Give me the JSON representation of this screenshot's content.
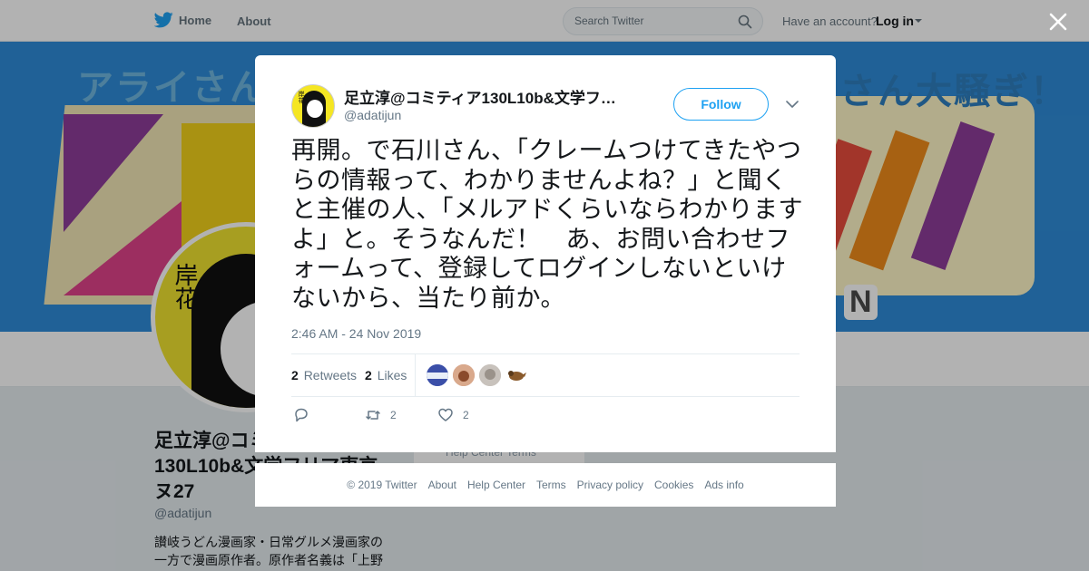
{
  "nav": {
    "home_label": "Home",
    "about_label": "About",
    "search_placeholder": "Search Twitter",
    "account_prompt": "Have an account?",
    "login_label": "Log in"
  },
  "profile": {
    "banner_text_left": "アライさん",
    "banner_text_right": "さん大騒ぎ！",
    "banner_n": "N",
    "avatar_text": "岸花",
    "name": "足立淳@コミティア130L10b&文学フリマ東京ヌ27",
    "handle": "@adatijun",
    "bio": "讃岐うどん漫画家・日常グルメ漫画家の一方で漫画原作者。原作者名義は「上野",
    "bg_links": "Help Center    Terms"
  },
  "tweet": {
    "author_name": "足立淳@コミティア130L10b&文学フリマ東京ヌ27",
    "author_handle": "@adatijun",
    "avatar_text": "岸花",
    "follow_label": "Follow",
    "text": "再開。で石川さん、「クレームつけてきたやつらの情報って、わかりませんよね？」と聞くと主催の人、「メルアドくらいならわかりますよ」と。そうなんだ！　あ、お問い合わせフォームって、登録してログインしないといけないから、当たり前か。",
    "timestamp": "2:46 AM - 24 Nov 2019",
    "retweets_count": "2",
    "retweets_label": "Retweets",
    "likes_count": "2",
    "likes_label": "Likes",
    "likers": [
      {
        "name": "liker-1",
        "color": "#5b6ec7"
      },
      {
        "name": "liker-2",
        "color": "#c98a6b"
      },
      {
        "name": "liker-3",
        "color": "#b8b0a8"
      },
      {
        "name": "liker-4",
        "color": "#8a5a2b"
      }
    ],
    "reply_count": "",
    "retweet_action_count": "2",
    "like_action_count": "2"
  },
  "footer": {
    "copyright": "© 2019 Twitter",
    "links": [
      "About",
      "Help Center",
      "Terms",
      "Privacy policy",
      "Cookies",
      "Ads info"
    ]
  },
  "colors": {
    "brand": "#1da1f2",
    "text_secondary": "#657786"
  }
}
